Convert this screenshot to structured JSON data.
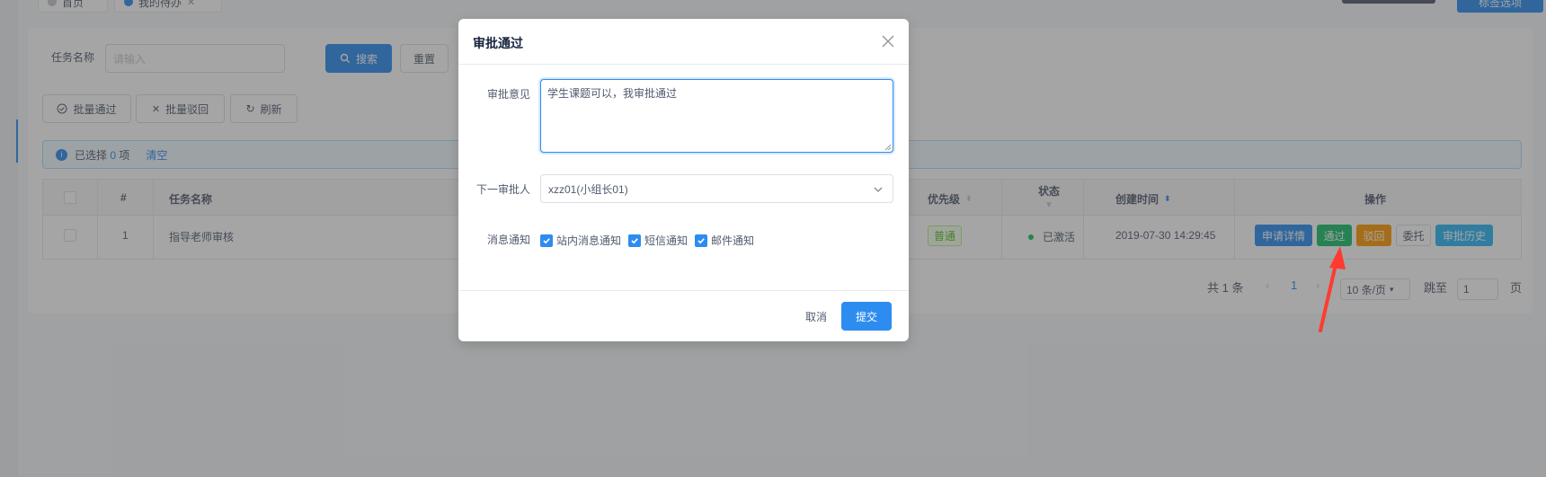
{
  "tabs": [
    {
      "label": "首页"
    },
    {
      "label": "我的待办"
    }
  ],
  "header": {
    "tag_options": "标签选项"
  },
  "search": {
    "label": "任务名称",
    "placeholder": "请输入",
    "search_btn": "搜索",
    "reset_btn": "重置"
  },
  "toolbar": {
    "batch_pass": "批量通过",
    "batch_reject": "批量驳回",
    "refresh": "刷新"
  },
  "selection": {
    "prefix": "已选择",
    "count": "0",
    "suffix": "项",
    "clear": "清空"
  },
  "table": {
    "headers": {
      "index": "#",
      "task_name": "任务名称",
      "priority": "优先级",
      "status": "状态",
      "created": "创建时间",
      "actions": "操作"
    },
    "rows": [
      {
        "index": "1",
        "task_name": "指导老师审核",
        "priority": "普通",
        "status": "已激活",
        "created": "2019-07-30 14:29:45"
      }
    ],
    "action_buttons": {
      "detail": "申请详情",
      "pass": "通过",
      "reject": "驳回",
      "delegate": "委托",
      "history": "审批历史"
    }
  },
  "pagination": {
    "total": "共 1 条",
    "current_page": "1",
    "page_size": "10 条/页",
    "jump_label": "跳至",
    "jump_value": "1",
    "page_suffix": "页"
  },
  "modal": {
    "title": "审批通过",
    "opinion_label": "审批意见",
    "opinion_value": "学生课题可以，我审批通过",
    "next_approver_label": "下一审批人",
    "next_approver_value": "xzz01(小组长01)",
    "notify_label": "消息通知",
    "notify_options": [
      {
        "label": "站内消息通知",
        "checked": true
      },
      {
        "label": "短信通知",
        "checked": true
      },
      {
        "label": "邮件通知",
        "checked": true
      }
    ],
    "cancel": "取消",
    "submit": "提交"
  },
  "colors": {
    "primary": "#2d8cf0",
    "success": "#19be6b",
    "warning": "#ff9900",
    "info": "#2db7f5",
    "annotation_arrow": "#ff3b30"
  }
}
